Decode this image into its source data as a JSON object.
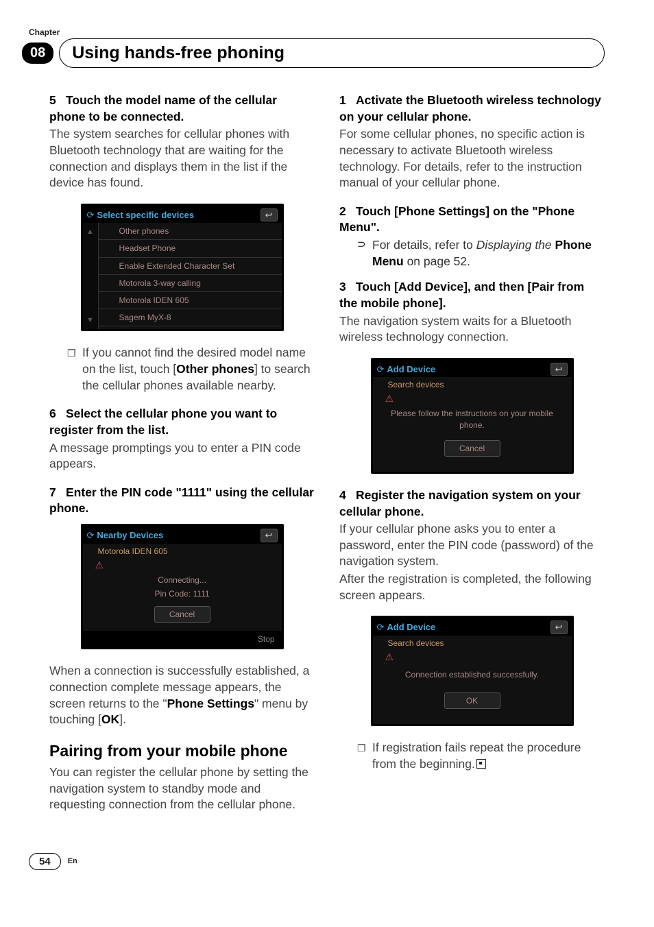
{
  "chapterLabel": "Chapter",
  "chapterNum": "08",
  "chapterTitle": "Using hands-free phoning",
  "left": {
    "step5": {
      "head": "Touch the model name of the cellular phone to be connected.",
      "body": "The system searches for cellular phones with Bluetooth technology that are waiting for the connection and displays them in the list if the device has found."
    },
    "shot1": {
      "title": "Select specific devices",
      "rows": [
        "Other phones",
        "Headset Phone",
        "Enable Extended Character Set",
        "Motorola 3-way calling",
        "Motorola IDEN 605",
        "Sagem MyX-8"
      ]
    },
    "note1": {
      "pre": "If you cannot find the desired model name on the list, touch [",
      "bold": "Other phones",
      "post": "] to search the cellular phones available nearby."
    },
    "step6": {
      "head": "Select the cellular phone you want to register from the list.",
      "body": "A message promptings you to enter a PIN code appears."
    },
    "step7": {
      "head": "Enter the PIN code \"1111\" using the cellular phone."
    },
    "shot2": {
      "title": "Nearby Devices",
      "row": "Motorola IDEN 605",
      "line1": "Connecting...",
      "line2": "Pin Code: 1111",
      "btn": "Cancel",
      "footer": "Stop"
    },
    "afterShot2": {
      "pre": "When a connection is successfully established, a connection complete message appears, the screen returns to the \"",
      "b1": "Phone Settings",
      "mid": "\" menu by touching [",
      "b2": "OK",
      "post": "]."
    },
    "h2": "Pairing from your mobile phone",
    "h2body": "You can register the cellular phone by setting the navigation system to standby mode and requesting connection from the cellular phone."
  },
  "right": {
    "step1": {
      "head": "Activate the Bluetooth wireless technology on your cellular phone.",
      "body": "For some cellular phones, no specific action is necessary to activate Bluetooth wireless technology. For details, refer to the instruction manual of your cellular phone."
    },
    "step2": {
      "head": "Touch [Phone Settings] on the \"Phone Menu\"."
    },
    "step2ref": {
      "pre": "For details, refer to ",
      "it": "Displaying the ",
      "b": "Phone Menu",
      "post": " on page 52."
    },
    "step3": {
      "head": "Touch [Add Device], and then [Pair from the mobile phone].",
      "body": "The navigation system waits for a Bluetooth wireless technology connection."
    },
    "shot3": {
      "title": "Add Device",
      "sub": "Search devices",
      "msg": "Please follow the instructions on your mobile phone.",
      "btn": "Cancel"
    },
    "step4": {
      "head": "Register the navigation system on your cellular phone.",
      "body1": "If your cellular phone asks you to enter a password, enter the PIN code (password) of the navigation system.",
      "body2": "After the registration is completed, the following screen appears."
    },
    "shot4": {
      "title": "Add Device",
      "sub": "Search devices",
      "msg": "Connection established successfully.",
      "btn": "OK"
    },
    "note2": "If registration fails repeat the procedure from the beginning."
  },
  "footer": {
    "page": "54",
    "lang": "En"
  }
}
